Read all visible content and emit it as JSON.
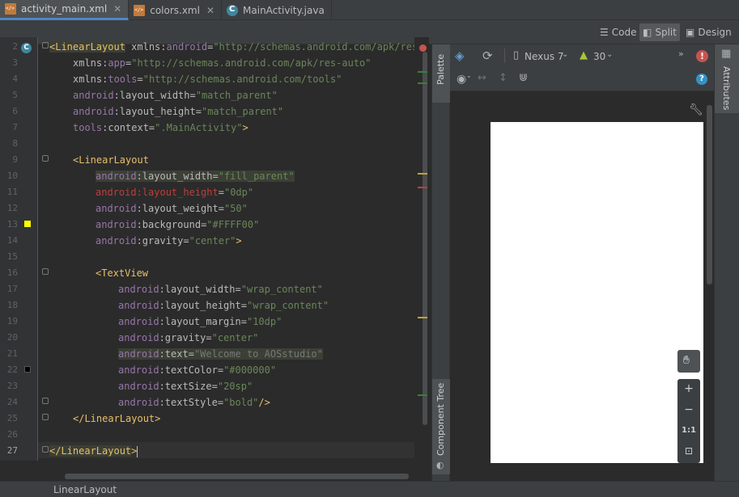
{
  "tabs": [
    {
      "label": "activity_main.xml",
      "icon": "xml-file-icon"
    },
    {
      "label": "colors.xml",
      "icon": "xml-file-icon"
    },
    {
      "label": "MainActivity.java",
      "icon": "java-class-icon"
    }
  ],
  "view_modes": {
    "code": "Code",
    "split": "Split",
    "design": "Design"
  },
  "gutter_marker": "C",
  "line_numbers": [
    "2",
    "3",
    "4",
    "5",
    "6",
    "7",
    "8",
    "9",
    "10",
    "11",
    "12",
    "13",
    "14",
    "15",
    "16",
    "17",
    "18",
    "19",
    "20",
    "21",
    "22",
    "23",
    "24",
    "25",
    "26",
    "27"
  ],
  "code": {
    "l2": {
      "tag": "<LinearLayout",
      "ns": " xmlns:",
      "attr": "android",
      "eq": "=",
      "val": "\"http://schemas.android.com/apk/res/an"
    },
    "l3": {
      "ns": "xmlns:",
      "attr": "app",
      "eq": "=",
      "val": "\"http://schemas.android.com/apk/res-auto\""
    },
    "l4": {
      "ns": "xmlns:",
      "attr": "tools",
      "eq": "=",
      "val": "\"http://schemas.android.com/tools\""
    },
    "l5": {
      "ns": "android",
      "attr": ":layout_width",
      "eq": "=",
      "val": "\"match_parent\""
    },
    "l6": {
      "ns": "android",
      "attr": ":layout_height",
      "eq": "=",
      "val": "\"match_parent\""
    },
    "l7": {
      "ns": "tools",
      "attr": ":context",
      "eq": "=",
      "val": "\".MainActivity\"",
      "close": ">"
    },
    "l9": {
      "tag": "<LinearLayout"
    },
    "l10": {
      "ns": "android",
      "attr": ":layout_width",
      "eq": "=",
      "val": "\"fill_parent\""
    },
    "l11": {
      "ns": "android",
      "attr": ":layout_height",
      "eq": "=",
      "val": "\"0dp\""
    },
    "l12": {
      "ns": "android",
      "attr": ":layout_weight",
      "eq": "=",
      "val": "\"50\""
    },
    "l13": {
      "ns": "android",
      "attr": ":background",
      "eq": "=",
      "val": "\"#FFFF00\""
    },
    "l14": {
      "ns": "android",
      "attr": ":gravity",
      "eq": "=",
      "val": "\"center\"",
      "close": ">"
    },
    "l16": {
      "tag": "<TextView"
    },
    "l17": {
      "ns": "android",
      "attr": ":layout_width",
      "eq": "=",
      "val": "\"wrap_content\""
    },
    "l18": {
      "ns": "android",
      "attr": ":layout_height",
      "eq": "=",
      "val": "\"wrap_content\""
    },
    "l19": {
      "ns": "android",
      "attr": ":layout_margin",
      "eq": "=",
      "val": "\"10dp\""
    },
    "l20": {
      "ns": "android",
      "attr": ":gravity",
      "eq": "=",
      "val": "\"center\""
    },
    "l21": {
      "ns": "android",
      "attr": ":text",
      "eq": "=",
      "val": "\"Welcome to AOSstudio\""
    },
    "l22": {
      "ns": "android",
      "attr": ":textColor",
      "eq": "=",
      "val": "\"#000000\""
    },
    "l23": {
      "ns": "android",
      "attr": ":textSize",
      "eq": "=",
      "val": "\"20sp\""
    },
    "l24": {
      "ns": "android",
      "attr": ":textStyle",
      "eq": "=",
      "val": "\"bold\"",
      "close": "/>"
    },
    "l25": {
      "tag": "</LinearLayout>"
    },
    "l27": {
      "tag": "</LinearLayout",
      "close": ">"
    }
  },
  "design": {
    "palette_label": "Palette",
    "component_tree_label": "Component Tree",
    "attributes_label": "Attributes",
    "device": "Nexus 7",
    "api_level": "30",
    "zoom_actual": "1:1",
    "zoom_in": "+",
    "zoom_out": "−",
    "help": "?",
    "device_screen_color": "#FFFFFF"
  },
  "status": {
    "breadcrumb": "LinearLayout"
  },
  "colors": {
    "tag": "#e8bf6a",
    "value": "#6a8759",
    "namespace": "#9876aa",
    "error": "#bc3f3c",
    "accent": "#4a88c7"
  }
}
